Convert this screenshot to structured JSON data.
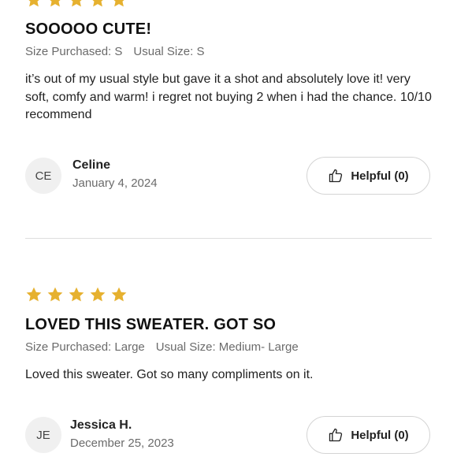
{
  "reviews": [
    {
      "rating": 5,
      "title": "SOOOOO CUTE!",
      "size_purchased": "Size Purchased: S",
      "usual_size": "Usual Size: S",
      "body": "it’s out of my usual style but gave it a shot and absolutely love it! very soft, comfy and warm! i regret not buying 2 when i had the chance. 10/10 recommend",
      "initials": "CE",
      "name": "Celine",
      "date": "January 4, 2024",
      "helpful_label": "Helpful (0)"
    },
    {
      "rating": 5,
      "title": "LOVED THIS SWEATER. GOT SO",
      "size_purchased": "Size Purchased: Large",
      "usual_size": "Usual Size: Medium- Large",
      "body": "Loved this sweater. Got so many compliments on it.",
      "initials": "JE",
      "name": "Jessica H.",
      "date": "December 25, 2023",
      "helpful_label": "Helpful (0)"
    }
  ],
  "colors": {
    "star": "#e6b12f",
    "divider": "#dedede",
    "muted_text": "#6b6b6b"
  },
  "icons": {
    "star": "star-icon",
    "helpful": "thumbs-up-icon"
  }
}
